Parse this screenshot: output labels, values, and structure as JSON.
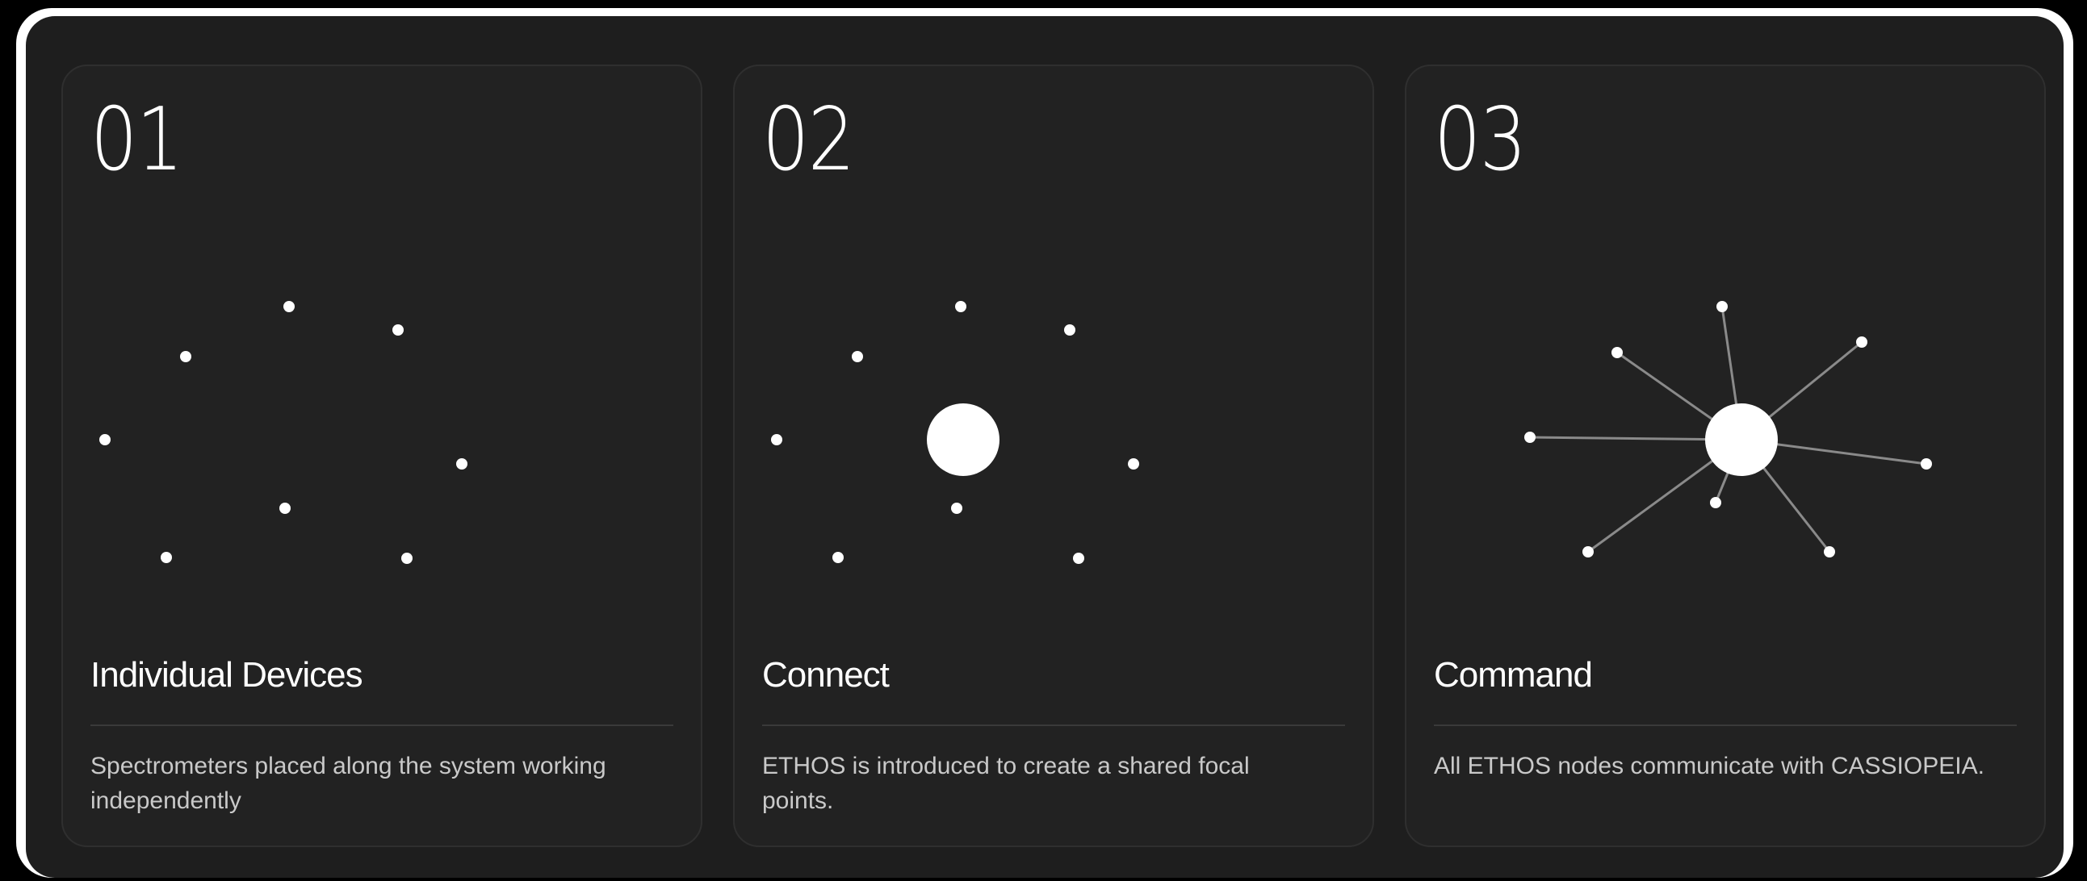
{
  "cards": [
    {
      "number": "01",
      "title": "Individual Devices",
      "description": "Spectrometers placed along the system working independently",
      "graphic": "scattered-nodes"
    },
    {
      "number": "02",
      "title": "Connect",
      "description": "ETHOS is introduced to create a shared focal points.",
      "graphic": "nodes-with-hub"
    },
    {
      "number": "03",
      "title": "Command",
      "description": "All ETHOS nodes communicate with CASSIOPEIA.",
      "graphic": "connected-hub"
    }
  ],
  "colors": {
    "background": "#000000",
    "frame": "#ffffff",
    "panel": "#1e1e1e",
    "card": "#222222",
    "text": "#ffffff",
    "description": "#c9c9c9",
    "connector": "#8a8a8a"
  }
}
